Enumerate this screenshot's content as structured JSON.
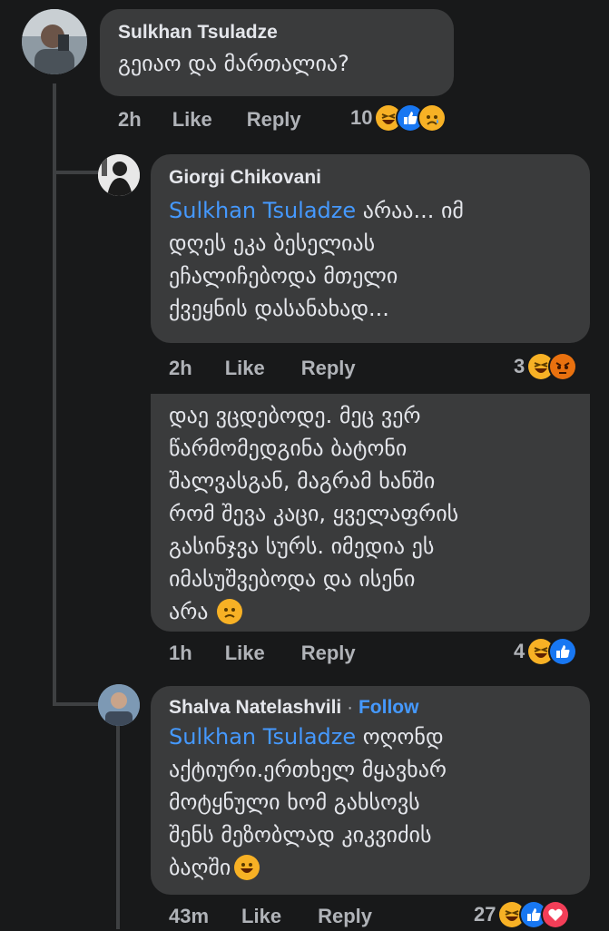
{
  "comments": [
    {
      "author": "Sulkhan Tsuladze",
      "text": "გეიაო და მართალია?",
      "time": "2h",
      "like": "Like",
      "reply": "Reply",
      "reaction_count": "10",
      "reactions": [
        "haha-icon",
        "like-icon",
        "sad-icon"
      ]
    },
    {
      "author": "Giorgi Chikovani",
      "mention": "Sulkhan Tsuladze",
      "lines": [
        "არაა... იმ",
        "დღეს ეკა ბესელიას",
        "ეჩალიჩებოდა მთელი",
        "ქვეყნის დასანახად..."
      ],
      "time": "2h",
      "like": "Like",
      "reply": "Reply",
      "reaction_count": "3",
      "reactions": [
        "haha-icon",
        "angry-icon"
      ]
    },
    {
      "lines": [
        "დაე ვცდებოდე. მეც ვერ",
        "წარმომედგინა ბატონი",
        "შალვასგან, მაგრამ ხანში",
        "რომ შევა კაცი, ყველაფრის",
        "გასინჯვა სურს. იმედია ეს",
        "იმასუშვებოდა და ისენი",
        "არა"
      ],
      "time": "1h",
      "like": "Like",
      "reply": "Reply",
      "reaction_count": "4",
      "reactions": [
        "haha-icon",
        "like-icon"
      ]
    },
    {
      "author": "Shalva Natelashvili",
      "separator": "·",
      "follow": "Follow",
      "mention": "Sulkhan Tsuladze",
      "lines": [
        "ოღონდ",
        "აქტიური.ერთხელ მყავხარ",
        "მოტყნული ხომ გახსოვს",
        "შენს მეზობლად კიკვიძის",
        "ბაღში"
      ],
      "time": "43m",
      "like": "Like",
      "reply": "Reply",
      "reaction_count": "27",
      "reactions": [
        "haha-icon",
        "like-icon",
        "love-icon"
      ]
    }
  ],
  "colors": {
    "background": "#18191a",
    "bubble": "#3a3b3c",
    "mention": "#4599ff",
    "meta": "#b0b3b8",
    "haha": "#f7b125",
    "like": "#1877f2",
    "love": "#f33e58",
    "angry": "#e9710f"
  }
}
